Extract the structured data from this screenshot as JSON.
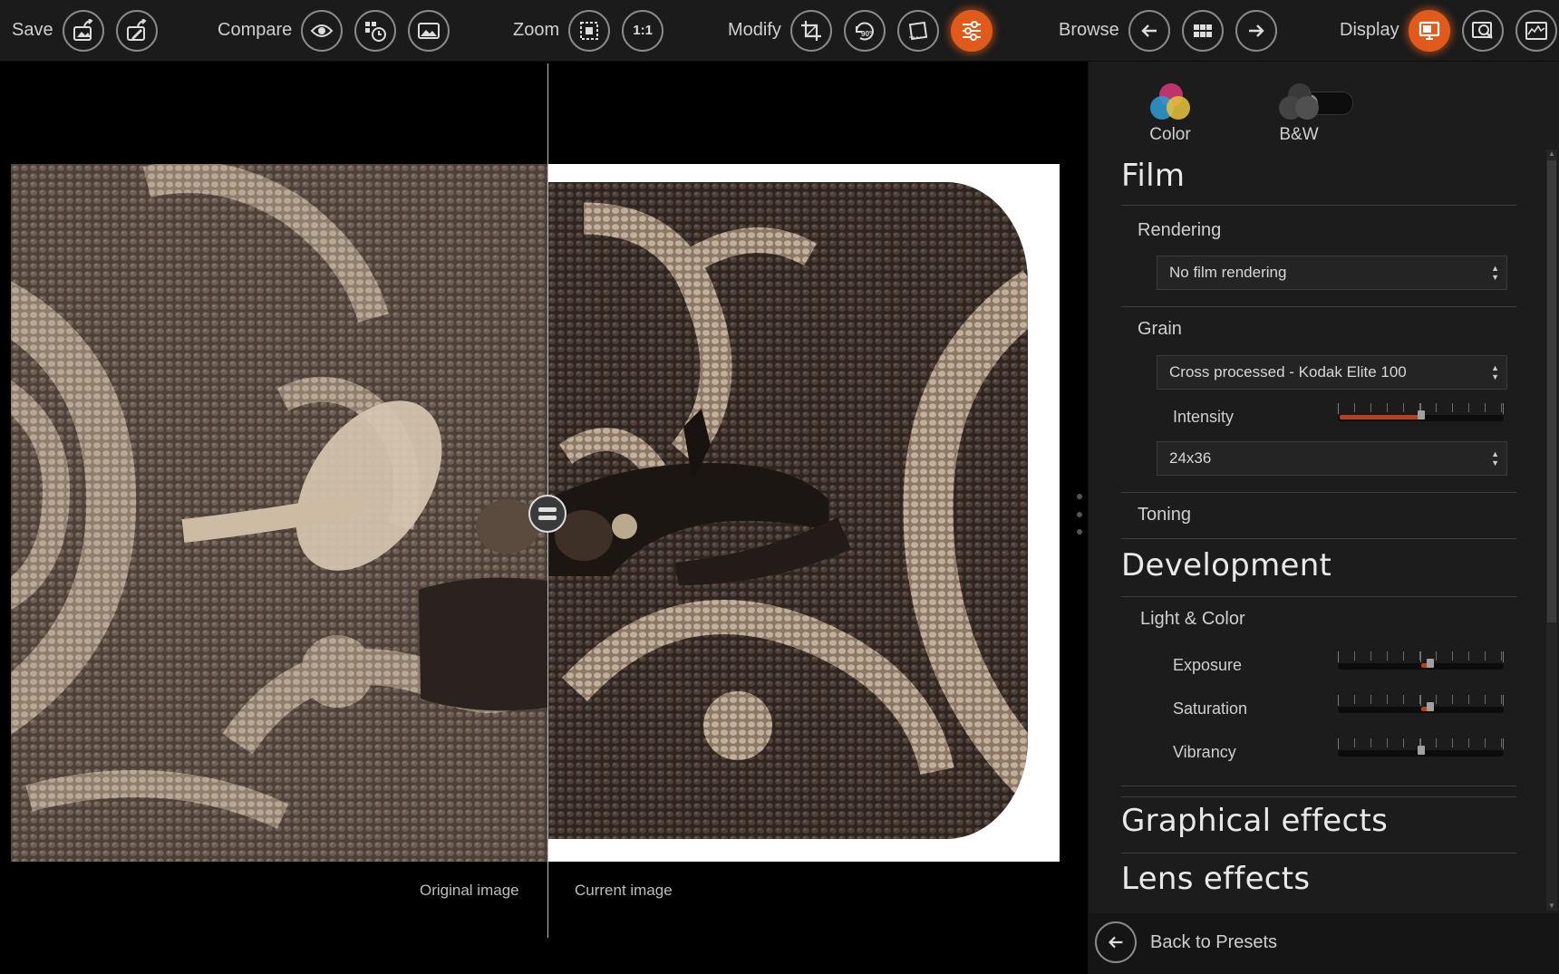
{
  "toolbar": {
    "save": {
      "label": "Save",
      "buttons": [
        "save-export-icon",
        "save-edit-export-icon"
      ]
    },
    "compare": {
      "label": "Compare",
      "buttons": [
        "eye-icon",
        "history-compare-icon",
        "image-icon"
      ]
    },
    "zoom": {
      "label": "Zoom",
      "fit_icon": "zoom-fit-icon",
      "one_to_one": "1:1"
    },
    "modify": {
      "label": "Modify",
      "buttons": [
        "crop-icon",
        "rotate-90-icon",
        "straighten-icon",
        "adjustments-icon"
      ],
      "active": "adjustments-icon"
    },
    "browse": {
      "label": "Browse",
      "buttons": [
        "arrow-left-icon",
        "grid-icon",
        "arrow-right-icon"
      ]
    },
    "display": {
      "label": "Display",
      "buttons": [
        "monitor-icon",
        "loupe-icon",
        "histogram-icon"
      ],
      "active": "monitor-icon"
    }
  },
  "viewer": {
    "original_caption": "Original image",
    "current_caption": "Current image"
  },
  "panel": {
    "color_mode": {
      "color_label": "Color",
      "bw_label": "B&W",
      "bw_enabled": false
    },
    "film": {
      "title": "Film",
      "rendering": {
        "label": "Rendering",
        "value": "No film rendering"
      },
      "grain": {
        "label": "Grain",
        "type": "Cross processed - Kodak Elite 100",
        "intensity": {
          "label": "Intensity",
          "value": 0.5
        },
        "format": "24x36"
      },
      "toning": {
        "label": "Toning"
      }
    },
    "development": {
      "title": "Development",
      "light_color": {
        "label": "Light & Color",
        "sliders": [
          {
            "label": "Exposure",
            "value": 0.56
          },
          {
            "label": "Saturation",
            "value": 0.56
          },
          {
            "label": "Vibrancy",
            "value": 0.5
          }
        ]
      }
    },
    "graphical_effects": {
      "title": "Graphical effects"
    },
    "lens_effects": {
      "title": "Lens effects"
    },
    "back_to_presets": "Back to Presets"
  },
  "colors": {
    "accent": "#e05a1c",
    "toolbar_bg": "#1b1b1b",
    "panel_bg": "#1c1c1c"
  }
}
